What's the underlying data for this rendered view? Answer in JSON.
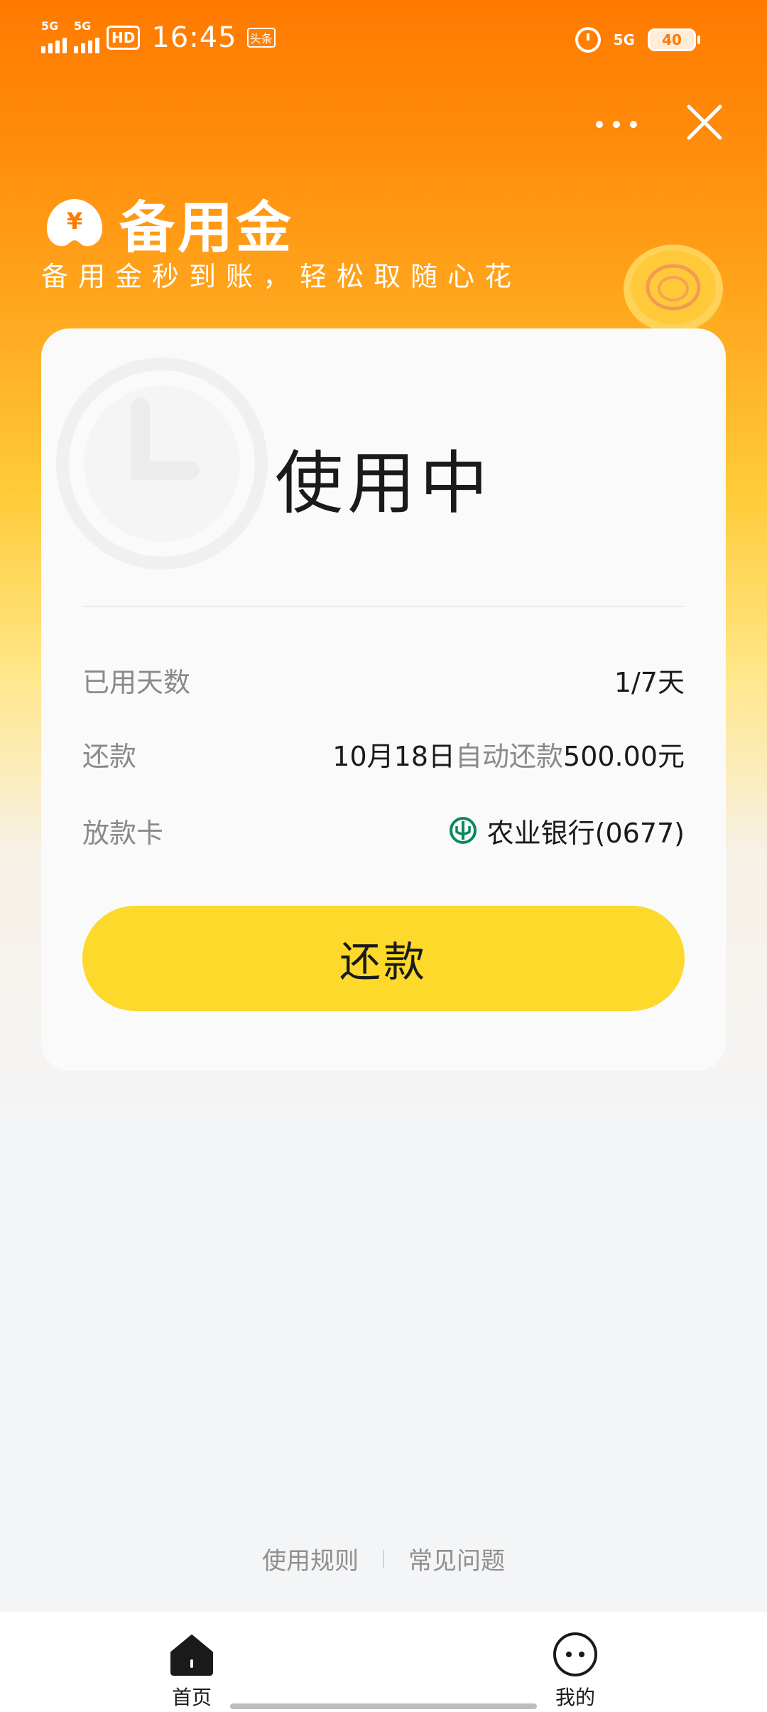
{
  "status_bar": {
    "signal1_label": "5G",
    "signal2_label": "5G",
    "hd_label": "HD",
    "time": "16:45",
    "news_badge": "头条",
    "net_label": "5G",
    "battery": "40"
  },
  "brand": {
    "title": "备用金",
    "subtitle": "备用金秒到账，轻松取随心花",
    "logo_symbol": "¥"
  },
  "card": {
    "status": "使用中",
    "rows": [
      {
        "label": "已用天数",
        "value": "1/7天"
      },
      {
        "label": "还款",
        "date": "10月18日",
        "mid": "自动还款",
        "amount": "500.00元"
      },
      {
        "label": "放款卡",
        "bank": "农业银行(0677)"
      }
    ],
    "button_label": "还款"
  },
  "footer": {
    "rules_label": "使用规则",
    "faq_label": "常见问题"
  },
  "nav": {
    "home_label": "首页",
    "mine_label": "我的"
  },
  "colors": {
    "accent_orange": "#ff7a00",
    "button_yellow": "#fdd92b",
    "bank_green": "#0a8a5a"
  }
}
